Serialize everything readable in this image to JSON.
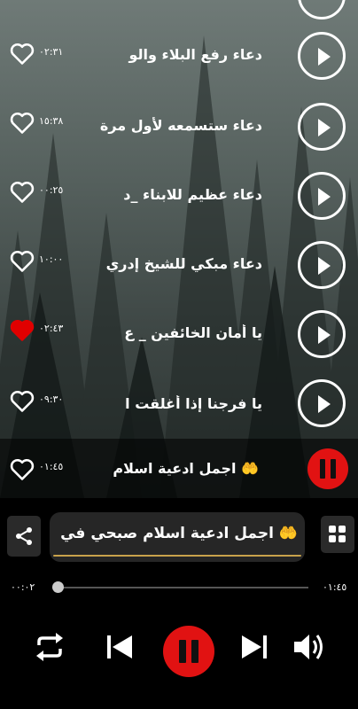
{
  "playlist": [
    {
      "title": "دعاء رفع البلاء والو",
      "duration": "٠٢:٣١",
      "favorite": false
    },
    {
      "title": "دعاء ستسمعه لأول مرة",
      "duration": "١٥:٣٨",
      "favorite": false
    },
    {
      "title": "دعاء عظيم للابناء _د",
      "duration": "٠٠:٢٥",
      "favorite": false
    },
    {
      "title": "دعاء مبكي للشيخ إدري",
      "duration": "١٠:٠٠",
      "favorite": false
    },
    {
      "title": "يا أمان الخائفين _ ع",
      "duration": "٠٢:٤٣",
      "favorite": true
    },
    {
      "title": "يا فرجنا إذا أغلقت ا",
      "duration": "٠٩:٣٠",
      "favorite": false
    }
  ],
  "current_row": {
    "title": "🤲 اجمل ادعية اسلام",
    "duration": "٠١:٤٥",
    "favorite": false
  },
  "player": {
    "now_playing": "🤲 اجمل ادعية اسلام صبحي في",
    "elapsed": "٠٠:٠٢",
    "total": "٠١:٤٥",
    "progress": 0.02
  },
  "colors": {
    "accent": "#e11212",
    "favorite": "#e00000",
    "marquee_underline": "#c8a24b"
  },
  "icons": [
    "heart-icon",
    "play-icon",
    "pause-icon",
    "share-icon",
    "grid-icon",
    "repeat-icon",
    "previous-icon",
    "next-icon",
    "volume-icon"
  ]
}
